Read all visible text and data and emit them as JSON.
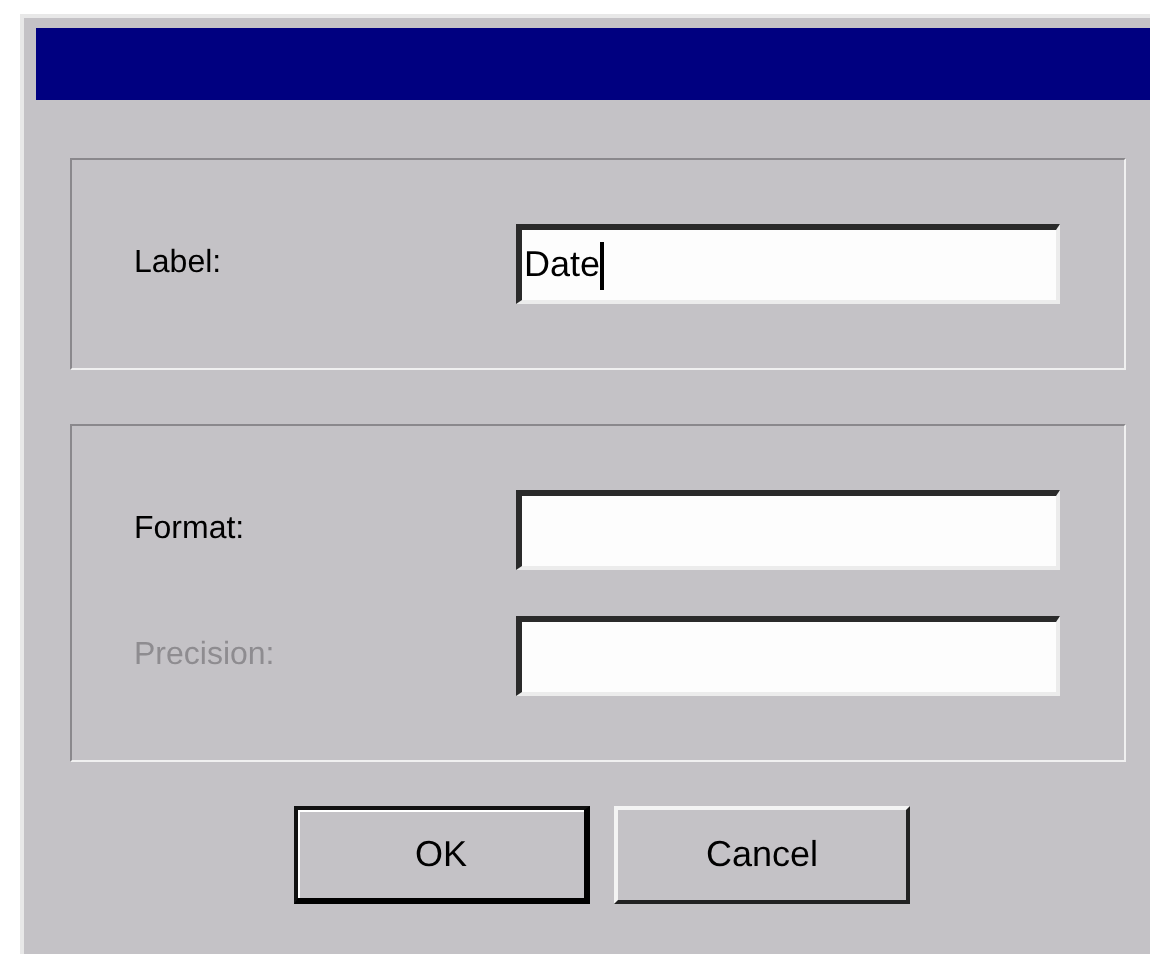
{
  "groups": [
    {
      "fields": [
        {
          "label": "Label:",
          "value": "Date",
          "disabled": false,
          "focused": true
        }
      ]
    },
    {
      "fields": [
        {
          "label": "Format:",
          "disabled": false,
          "focused": false
        },
        {
          "label": "Precision:",
          "disabled": true,
          "focused": false
        }
      ]
    }
  ],
  "buttons": [
    {
      "label": "OK",
      "default": true
    },
    {
      "label": "Cancel",
      "default": false
    }
  ]
}
